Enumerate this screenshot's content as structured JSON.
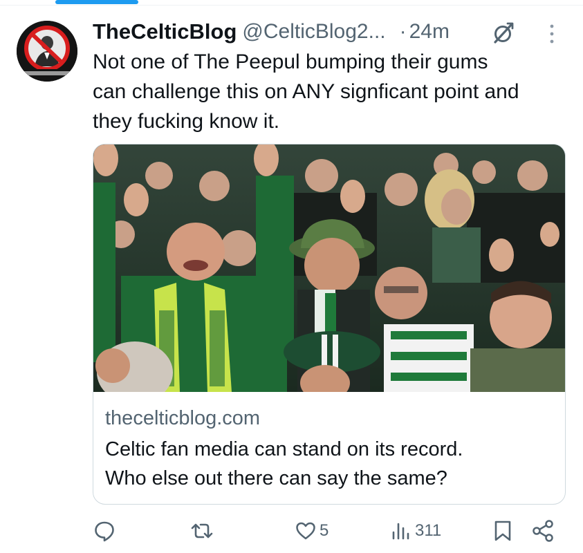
{
  "post": {
    "author": {
      "display_name": "TheCelticBlog",
      "handle": "@CelticBlog2...",
      "avatar_icon": "celtic-blog-avatar-icon"
    },
    "separator": "·",
    "timestamp": "24m",
    "text": "Not one of The Peepul bumping their gums\ncan challenge this on ANY signficant point and\nthey fucking know it.",
    "card": {
      "domain": "thecelticblog.com",
      "title": "Celtic fan media can stand on its record.\nWho else out there can say the same?"
    },
    "actions": {
      "reply": {
        "icon": "reply-icon",
        "count": ""
      },
      "repost": {
        "icon": "repost-icon",
        "count": ""
      },
      "like": {
        "icon": "heart-icon",
        "count": "5"
      },
      "views": {
        "icon": "views-icon",
        "count": "311"
      },
      "bookmark": {
        "icon": "bookmark-icon"
      },
      "share": {
        "icon": "share-icon"
      }
    }
  },
  "colors": {
    "accent": "#1d9bf0",
    "text_primary": "#0f1419",
    "text_secondary": "#536471",
    "border": "#cfd9de",
    "celtic_green": "#1f7a3a"
  }
}
